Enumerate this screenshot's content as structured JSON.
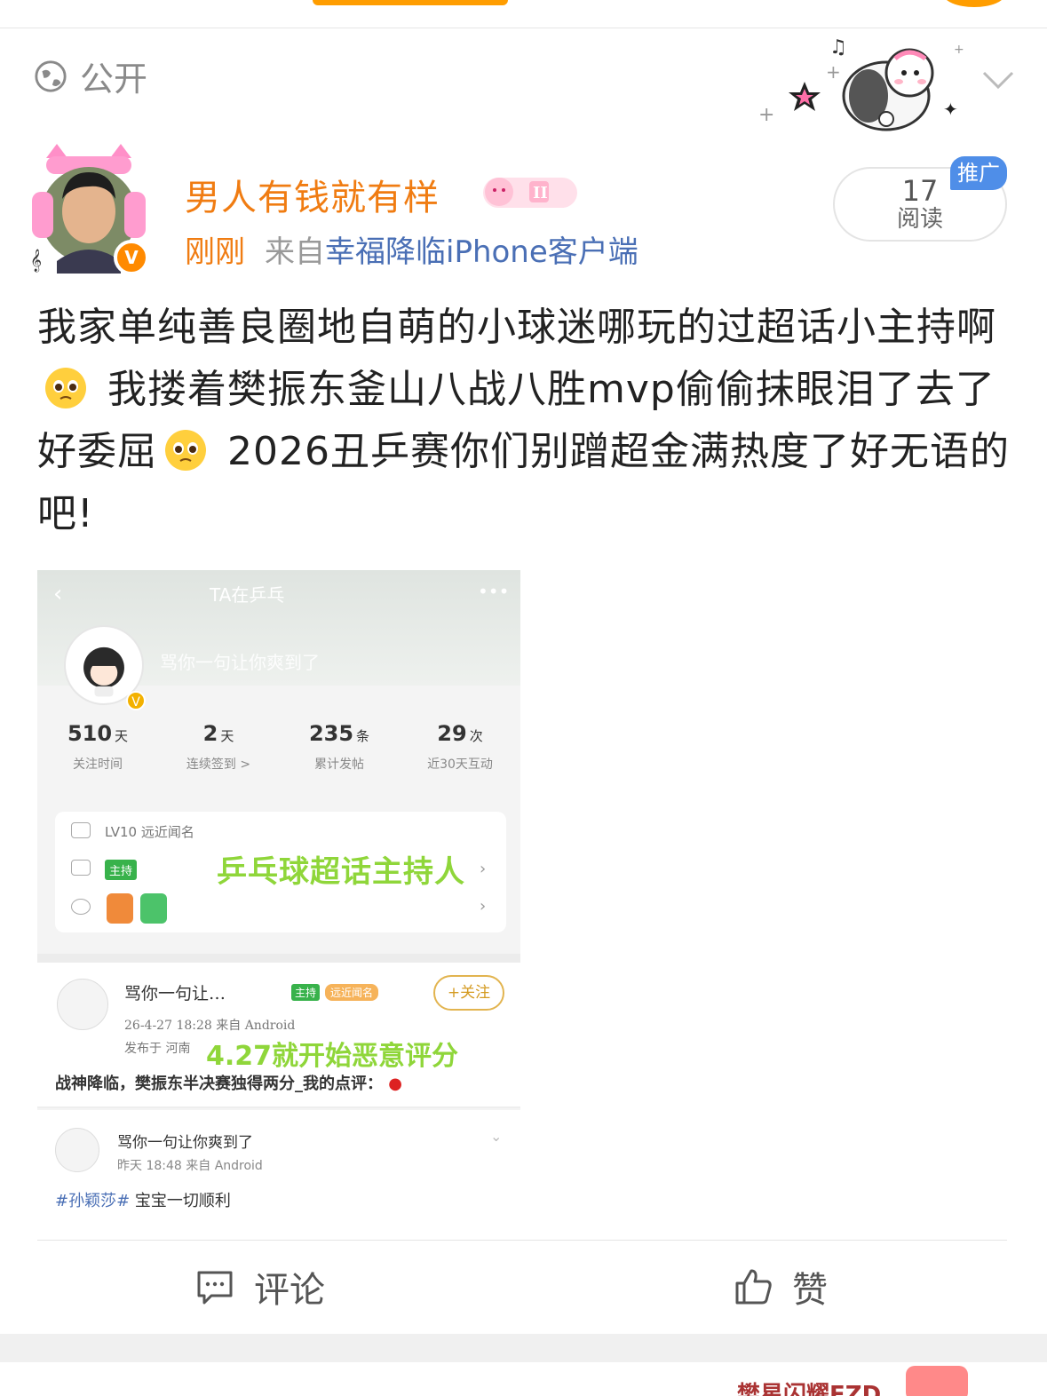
{
  "visibility": {
    "label": "公开"
  },
  "author": {
    "name": "男人有钱就有样",
    "time": "刚刚",
    "source_prefix": "来自",
    "source": "幸福降临iPhone客户端"
  },
  "reads": {
    "count": "17",
    "label": "阅读",
    "promo": "推广"
  },
  "post": {
    "line1": "我家单纯善良圈地自萌的小球迷哪玩的过超话小主持啊",
    "line2": "我搂着樊振东釜山八战八胜mvp偷偷抹眼泪了去了好委屈",
    "line3": "2026丑乒赛你们别蹭超金满热度了好无语的吧!"
  },
  "screenshot": {
    "title": "TA在乒乓",
    "nickname": "骂你一句让你爽到了",
    "stats": [
      {
        "num": "510",
        "unit": "天",
        "label": "关注时间"
      },
      {
        "num": "2",
        "unit": "天",
        "label": "连续签到 >"
      },
      {
        "num": "235",
        "unit": "条",
        "label": "累计发帖"
      },
      {
        "num": "29",
        "unit": "次",
        "label": "近30天互动"
      }
    ],
    "level": "LV10 远近闻名",
    "host_tag": "主持",
    "host_title": "乒乓球超话主持人",
    "post1": {
      "name": "骂你一句让…",
      "tag_host": "主持",
      "tag_level": "远近闻名",
      "follow": "+关注",
      "meta": "26-4-27 18:28  来自 Android",
      "location": "发布于 河南",
      "headline": "4.27就开始恶意评分",
      "text": "战神降临，樊振东半决赛独得两分_我的点评："
    },
    "post2": {
      "name": "骂你一句让你爽到了",
      "meta": "昨天 18:48  来自 Android",
      "topic": "#孙颖莎#",
      "text": " 宝宝一切顺利"
    }
  },
  "actions": {
    "comment": "评论",
    "like": "赞"
  },
  "footer": {
    "promo_text": "樊星闪耀FZD"
  },
  "colors": {
    "accent": "#f07c12",
    "link": "#4a6fb5",
    "promo": "#4f8ee8",
    "green": "#8fd63a"
  }
}
